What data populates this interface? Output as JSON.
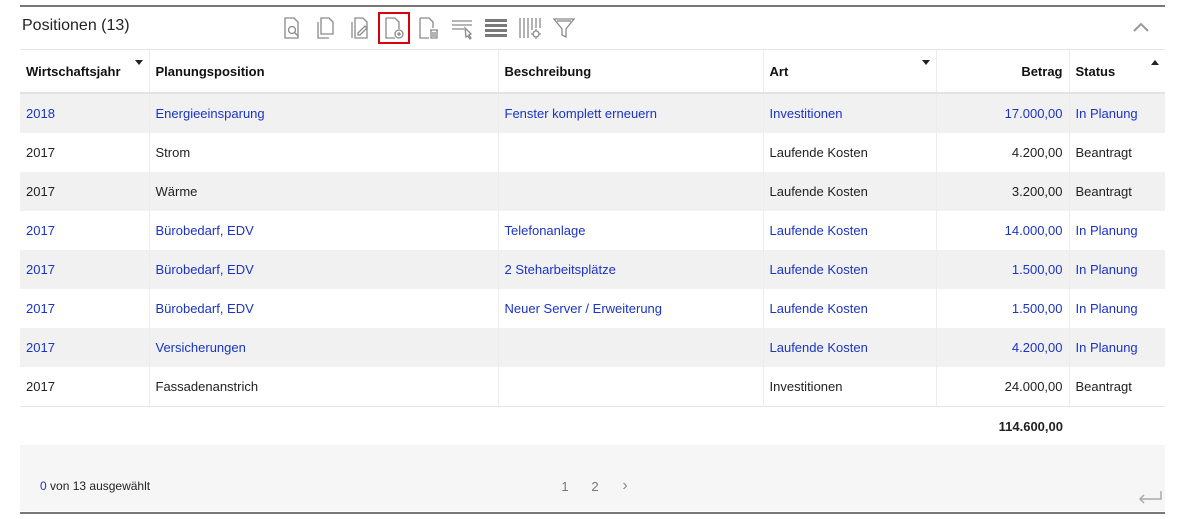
{
  "header": {
    "title": "Positionen (13)"
  },
  "toolbar": [
    {
      "icon": "document-search-icon"
    },
    {
      "icon": "copy-icon"
    },
    {
      "icon": "edit-document-icon"
    },
    {
      "icon": "add-document-icon",
      "active": true
    },
    {
      "icon": "delete-document-icon"
    },
    {
      "icon": "filter-row-icon"
    },
    {
      "icon": "list-view-icon"
    },
    {
      "icon": "column-settings-icon"
    },
    {
      "icon": "funnel-icon"
    }
  ],
  "columns": [
    "Wirtschaftsjahr",
    "Planungsposition",
    "Beschreibung",
    "Art",
    "Betrag",
    "Status"
  ],
  "rows": [
    {
      "jahr": "2018",
      "position": "Energieeinsparung",
      "beschreibung": "Fenster komplett erneuern",
      "art": "Investitionen",
      "betrag": "17.000,00",
      "status": "In Planung"
    },
    {
      "jahr": "2017",
      "position": "Strom",
      "beschreibung": "",
      "art": "Laufende Kosten",
      "betrag": "4.200,00",
      "status": "Beantragt"
    },
    {
      "jahr": "2017",
      "position": "Wärme",
      "beschreibung": "",
      "art": "Laufende Kosten",
      "betrag": "3.200,00",
      "status": "Beantragt"
    },
    {
      "jahr": "2017",
      "position": "Bürobedarf, EDV",
      "beschreibung": "Telefonanlage",
      "art": "Laufende Kosten",
      "betrag": "14.000,00",
      "status": "In Planung"
    },
    {
      "jahr": "2017",
      "position": "Bürobedarf, EDV",
      "beschreibung": "2 Steharbeitsplätze",
      "art": "Laufende Kosten",
      "betrag": "1.500,00",
      "status": "In Planung"
    },
    {
      "jahr": "2017",
      "position": "Bürobedarf, EDV",
      "beschreibung": "Neuer Server / Erweiterung",
      "art": "Laufende Kosten",
      "betrag": "1.500,00",
      "status": "In Planung"
    },
    {
      "jahr": "2017",
      "position": "Versicherungen",
      "beschreibung": "",
      "art": "Laufende Kosten",
      "betrag": "4.200,00",
      "status": "In Planung"
    },
    {
      "jahr": "2017",
      "position": "Fassadenanstrich",
      "beschreibung": "",
      "art": "Investitionen",
      "betrag": "24.000,00",
      "status": "Beantragt"
    }
  ],
  "total": "114.600,00",
  "footer": {
    "selected_count": "0",
    "selected_text": "von 13 ausgewählt",
    "pages": [
      "1",
      "2"
    ],
    "next": "›"
  },
  "colors": {
    "link": "#1a33c8",
    "accent_red": "#d8000c"
  }
}
